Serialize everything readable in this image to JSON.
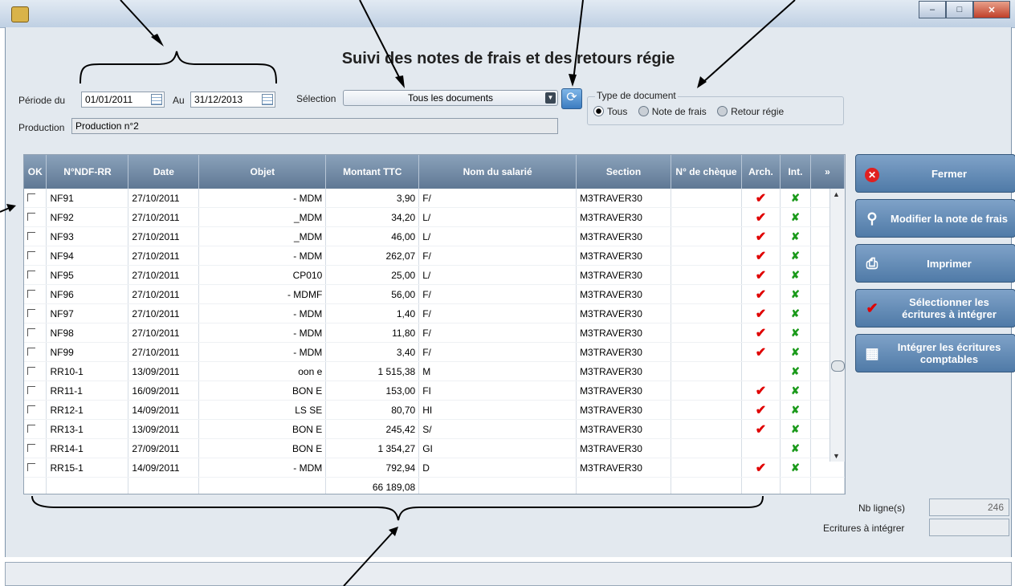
{
  "window": {
    "minimize": "–",
    "maximize": "□",
    "close": "✕"
  },
  "page_title": "Suivi des notes de frais et des retours régie",
  "filters": {
    "period_from_label": "Période du",
    "period_from": "01/01/2011",
    "period_to_label": "Au",
    "period_to": "31/12/2013",
    "selection_label": "Sélection",
    "selection_value": "Tous les documents",
    "production_label": "Production",
    "production_value": "Production n°2"
  },
  "doc_type": {
    "legend": "Type de document",
    "options": [
      "Tous",
      "Note de frais",
      "Retour régie"
    ],
    "selected": "Tous"
  },
  "table": {
    "headers": [
      "OK",
      "N°NDF-RR",
      "Date",
      "Objet",
      "Montant TTC",
      "Nom du salarié",
      "Section",
      "N° de chèque",
      "Arch.",
      "Int."
    ],
    "rows": [
      {
        "ndf": "NF91",
        "date": "27/10/2011",
        "objet": "- MDM",
        "montant": "3,90",
        "nom": "F/",
        "section": "M3TRAVER30",
        "arch": true,
        "int": true
      },
      {
        "ndf": "NF92",
        "date": "27/10/2011",
        "objet": "_MDM",
        "montant": "34,20",
        "nom": "L/",
        "section": "M3TRAVER30",
        "arch": true,
        "int": true
      },
      {
        "ndf": "NF93",
        "date": "27/10/2011",
        "objet": "_MDM",
        "montant": "46,00",
        "nom": "L/",
        "section": "M3TRAVER30",
        "arch": true,
        "int": true
      },
      {
        "ndf": "NF94",
        "date": "27/10/2011",
        "objet": "- MDM",
        "montant": "262,07",
        "nom": "F/",
        "section": "M3TRAVER30",
        "arch": true,
        "int": true
      },
      {
        "ndf": "NF95",
        "date": "27/10/2011",
        "objet": "CP010",
        "montant": "25,00",
        "nom": "L/",
        "section": "M3TRAVER30",
        "arch": true,
        "int": true
      },
      {
        "ndf": "NF96",
        "date": "27/10/2011",
        "objet": "- MDMF",
        "montant": "56,00",
        "nom": "F/",
        "section": "M3TRAVER30",
        "arch": true,
        "int": true
      },
      {
        "ndf": "NF97",
        "date": "27/10/2011",
        "objet": "- MDM",
        "montant": "1,40",
        "nom": "F/",
        "section": "M3TRAVER30",
        "arch": true,
        "int": true
      },
      {
        "ndf": "NF98",
        "date": "27/10/2011",
        "objet": "- MDM",
        "montant": "11,80",
        "nom": "F/",
        "section": "M3TRAVER30",
        "arch": true,
        "int": true
      },
      {
        "ndf": "NF99",
        "date": "27/10/2011",
        "objet": "- MDM",
        "montant": "3,40",
        "nom": "F/",
        "section": "M3TRAVER30",
        "arch": true,
        "int": true
      },
      {
        "ndf": "RR10-1",
        "date": "13/09/2011",
        "objet": "oon e",
        "montant": "1 515,38",
        "nom": "M",
        "section": "M3TRAVER30",
        "arch": false,
        "int": true
      },
      {
        "ndf": "RR11-1",
        "date": "16/09/2011",
        "objet": "BON E",
        "montant": "153,00",
        "nom": "FI",
        "section": "M3TRAVER30",
        "arch": true,
        "int": true
      },
      {
        "ndf": "RR12-1",
        "date": "14/09/2011",
        "objet": "LS SE",
        "montant": "80,70",
        "nom": "HI",
        "section": "M3TRAVER30",
        "arch": true,
        "int": true
      },
      {
        "ndf": "RR13-1",
        "date": "13/09/2011",
        "objet": "BON E",
        "montant": "245,42",
        "nom": "S/",
        "section": "M3TRAVER30",
        "arch": true,
        "int": true
      },
      {
        "ndf": "RR14-1",
        "date": "27/09/2011",
        "objet": "BON E",
        "montant": "1 354,27",
        "nom": "GI",
        "section": "M3TRAVER30",
        "arch": false,
        "int": true
      },
      {
        "ndf": "RR15-1",
        "date": "14/09/2011",
        "objet": "- MDM",
        "montant": "792,94",
        "nom": "D",
        "section": "M3TRAVER30",
        "arch": true,
        "int": true
      }
    ],
    "total": "66 189,08"
  },
  "actions": [
    {
      "label": "Fermer",
      "icon": "close-circle-icon"
    },
    {
      "label": "Modifier la note de frais",
      "icon": "magnifier-icon"
    },
    {
      "label": "Imprimer",
      "icon": "printer-icon"
    },
    {
      "label": "Sélectionner les écritures à intégrer",
      "icon": "checkmark-icon"
    },
    {
      "label": "Intégrer les écritures comptables",
      "icon": "calculator-icon"
    }
  ],
  "counters": {
    "rows_label": "Nb ligne(s)",
    "rows_value": "246",
    "to_integrate_label": "Ecritures à intégrer",
    "to_integrate_value": ""
  }
}
